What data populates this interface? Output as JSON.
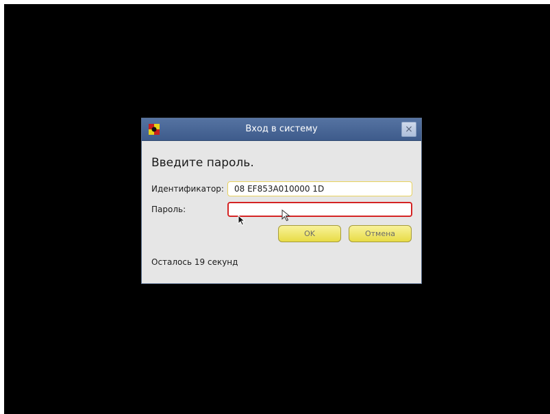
{
  "dialog": {
    "title": "Вход в систему",
    "heading": "Введите пароль.",
    "close_symbol": "×",
    "app_icon": "app-logo-icon",
    "identifier": {
      "label": "Идентификатор:",
      "value": "08 EF853A010000 1D"
    },
    "password": {
      "label": "Пароль:",
      "value": ""
    },
    "buttons": {
      "ok_label": "OK",
      "cancel_label": "Отмена"
    },
    "countdown": "Осталось 19 секунд"
  },
  "colors": {
    "titlebar": "#4a689a",
    "dialog_bg": "#e6e6e6",
    "button_yellow": "#f0e56e",
    "password_border": "#d42222",
    "identifier_border": "#e8d25c"
  },
  "cursors": [
    "mouse-pointer-icon",
    "hollow-pointer-icon"
  ]
}
